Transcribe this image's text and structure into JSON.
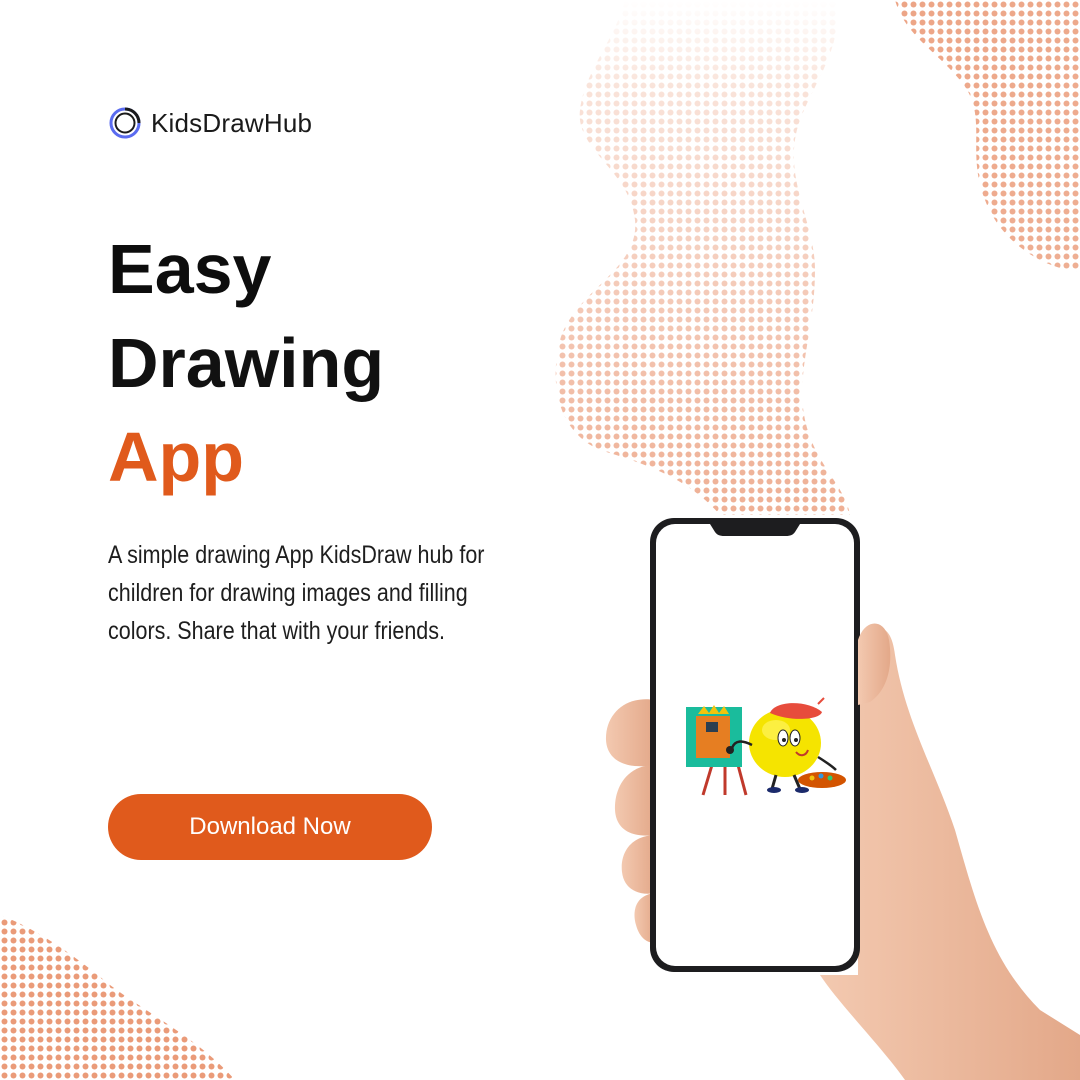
{
  "brand": {
    "name": "KidsDrawHub"
  },
  "headline": {
    "line1": "Easy",
    "line2": "Drawing",
    "line3": "App"
  },
  "description": "A simple drawing App KidsDraw hub for children for drawing images and filling colors. Share that with your friends.",
  "cta": {
    "label": "Download Now"
  },
  "colors": {
    "accent": "#e05a1c",
    "text": "#111111",
    "background": "#ffffff"
  },
  "icons": {
    "logo": "ring-logo-icon",
    "illustration": "painter-character-illustration"
  }
}
